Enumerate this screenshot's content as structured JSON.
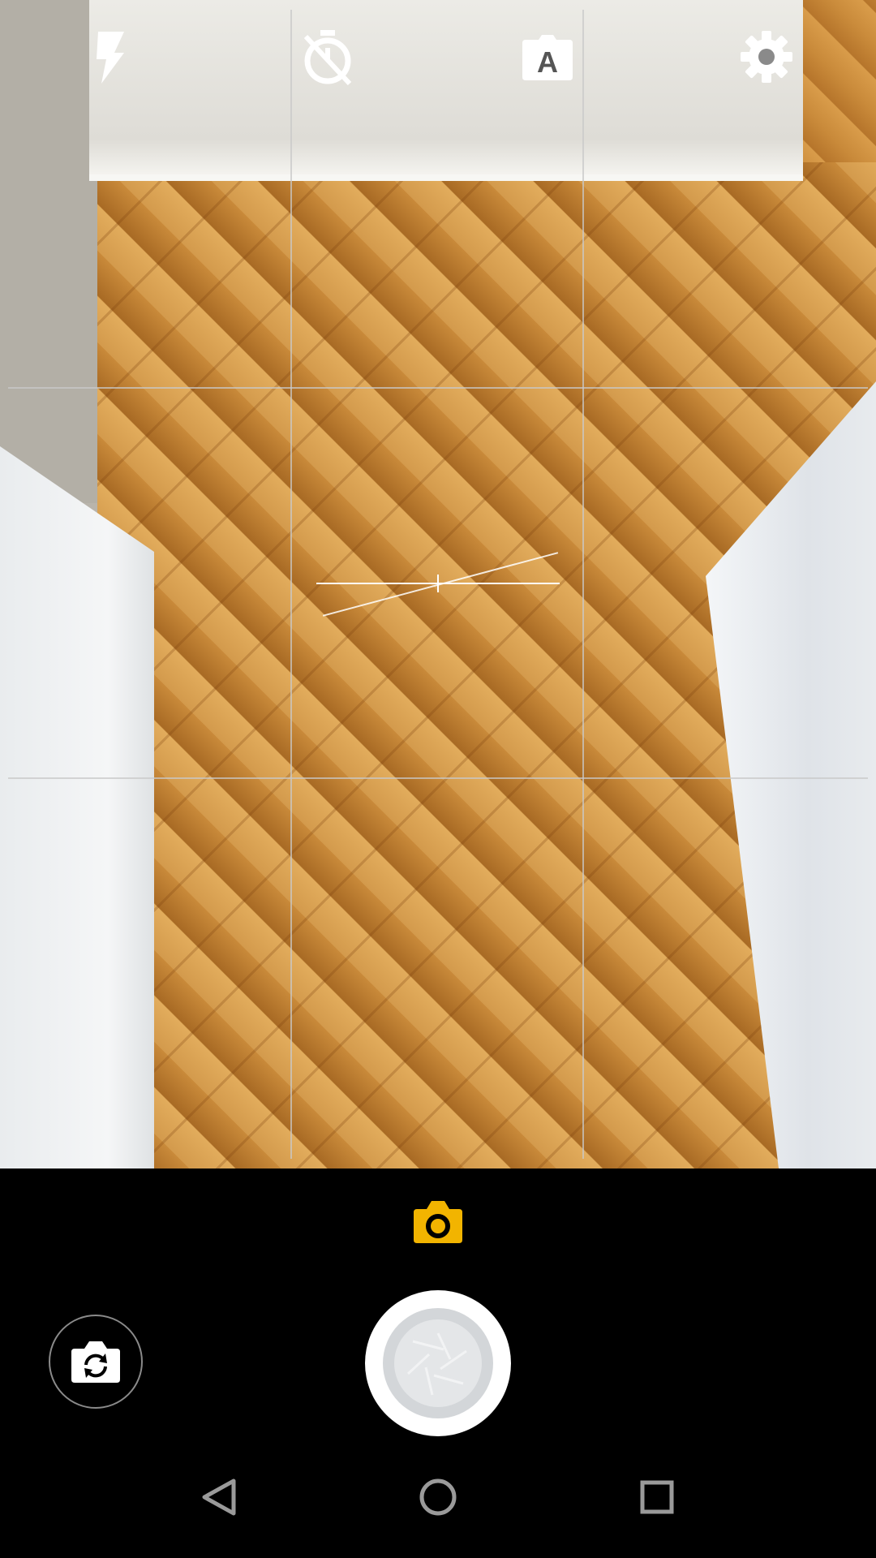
{
  "top_bar": {
    "flash_icon": "flash-icon",
    "timer_icon": "timer-off-icon",
    "auto_icon_label": "A",
    "settings_icon": "gear-icon"
  },
  "viewfinder": {
    "grid": "3x3",
    "level_indicator": true
  },
  "controls": {
    "mode_icon": "camera-icon",
    "mode_color": "#f2b400",
    "switch_camera_icon": "switch-camera-icon",
    "shutter_icon": "shutter-aperture-icon"
  },
  "nav_bar": {
    "back_icon": "back-triangle-icon",
    "home_icon": "home-circle-icon",
    "recents_icon": "recents-square-icon"
  }
}
